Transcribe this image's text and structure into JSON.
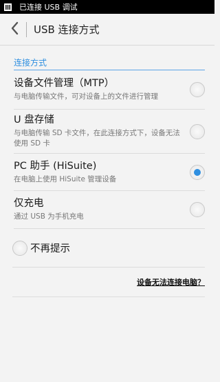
{
  "status_bar": {
    "text": "已连接 USB 调试",
    "icon": "usb-debug-icon"
  },
  "header": {
    "title": "USB 连接方式",
    "back_icon": "chevron-left-icon"
  },
  "section": {
    "title": "连接方式"
  },
  "options": [
    {
      "title": "设备文件管理（MTP）",
      "desc": "与电脑传输文件，可对设备上的文件进行管理",
      "checked": false
    },
    {
      "title": "U 盘存储",
      "desc": "与电脑传输 SD 卡文件，在此连接方式下，设备无法使用 SD 卡",
      "checked": false
    },
    {
      "title": "PC 助手 (HiSuite)",
      "desc": "在电脑上使用 HiSuite 管理设备",
      "checked": true
    },
    {
      "title": "仅充电",
      "desc": "通过 USB 为手机充电",
      "checked": false
    }
  ],
  "no_prompt": {
    "label": "不再提示",
    "checked": false
  },
  "help": {
    "link": "设备无法连接电脑？"
  },
  "colors": {
    "accent": "#2f8fe0",
    "status_bar": "#000000",
    "background": "#f3f3f3"
  }
}
